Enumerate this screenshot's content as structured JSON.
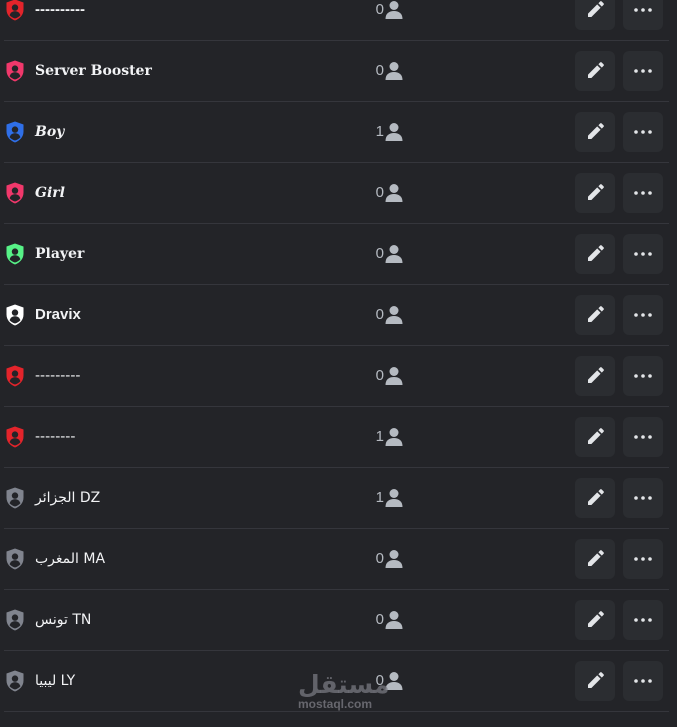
{
  "roles": [
    {
      "name": "----------",
      "count": "0",
      "color": "#e3242b",
      "style": "sans-bold"
    },
    {
      "name": "Server Booster",
      "count": "0",
      "color": "#f0386b",
      "style": "serif-bold"
    },
    {
      "name": "Boy",
      "count": "1",
      "color": "#2f6fe8",
      "style": "serif-italic"
    },
    {
      "name": "Girl",
      "count": "0",
      "color": "#f0386b",
      "style": "serif-italic"
    },
    {
      "name": "Player",
      "count": "0",
      "color": "#57f287",
      "style": "serif-bold"
    },
    {
      "name": "Dravix",
      "count": "0",
      "color": "#ffffff",
      "style": "sans-bold"
    },
    {
      "name": "---------",
      "count": "0",
      "color": "#e3242b",
      "style": "sans"
    },
    {
      "name": "--------",
      "count": "1",
      "color": "#e3242b",
      "style": "sans"
    },
    {
      "name": "الجزائر DZ",
      "count": "1",
      "color": "#80848e",
      "style": "sans"
    },
    {
      "name": "المغرب MA",
      "count": "0",
      "color": "#80848e",
      "style": "sans"
    },
    {
      "name": "تونس TN",
      "count": "0",
      "color": "#80848e",
      "style": "sans"
    },
    {
      "name": "ليبيا LY",
      "count": "0",
      "color": "#80848e",
      "style": "sans"
    }
  ],
  "icons": {
    "role": "shield-icon",
    "members": "members-icon",
    "edit": "pencil-icon",
    "more": "more-options-icon"
  },
  "watermark": {
    "arabic": "مستقل",
    "latin": "mostaql.com"
  }
}
